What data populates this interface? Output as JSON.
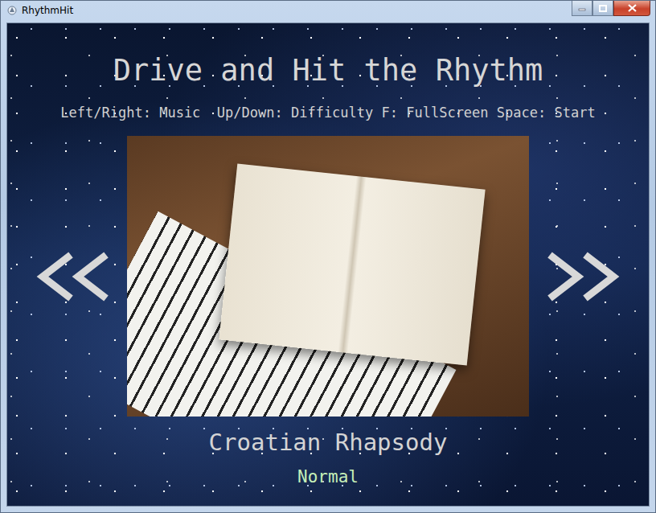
{
  "window": {
    "title": "RhythmHit"
  },
  "heading": "Drive and Hit the Rhythm",
  "instructions": "Left/Right: Music  Up/Down: Difficulty F: FullScreen Space: Start",
  "song": {
    "title": "Croatian Rhapsody",
    "difficulty": "Normal"
  }
}
